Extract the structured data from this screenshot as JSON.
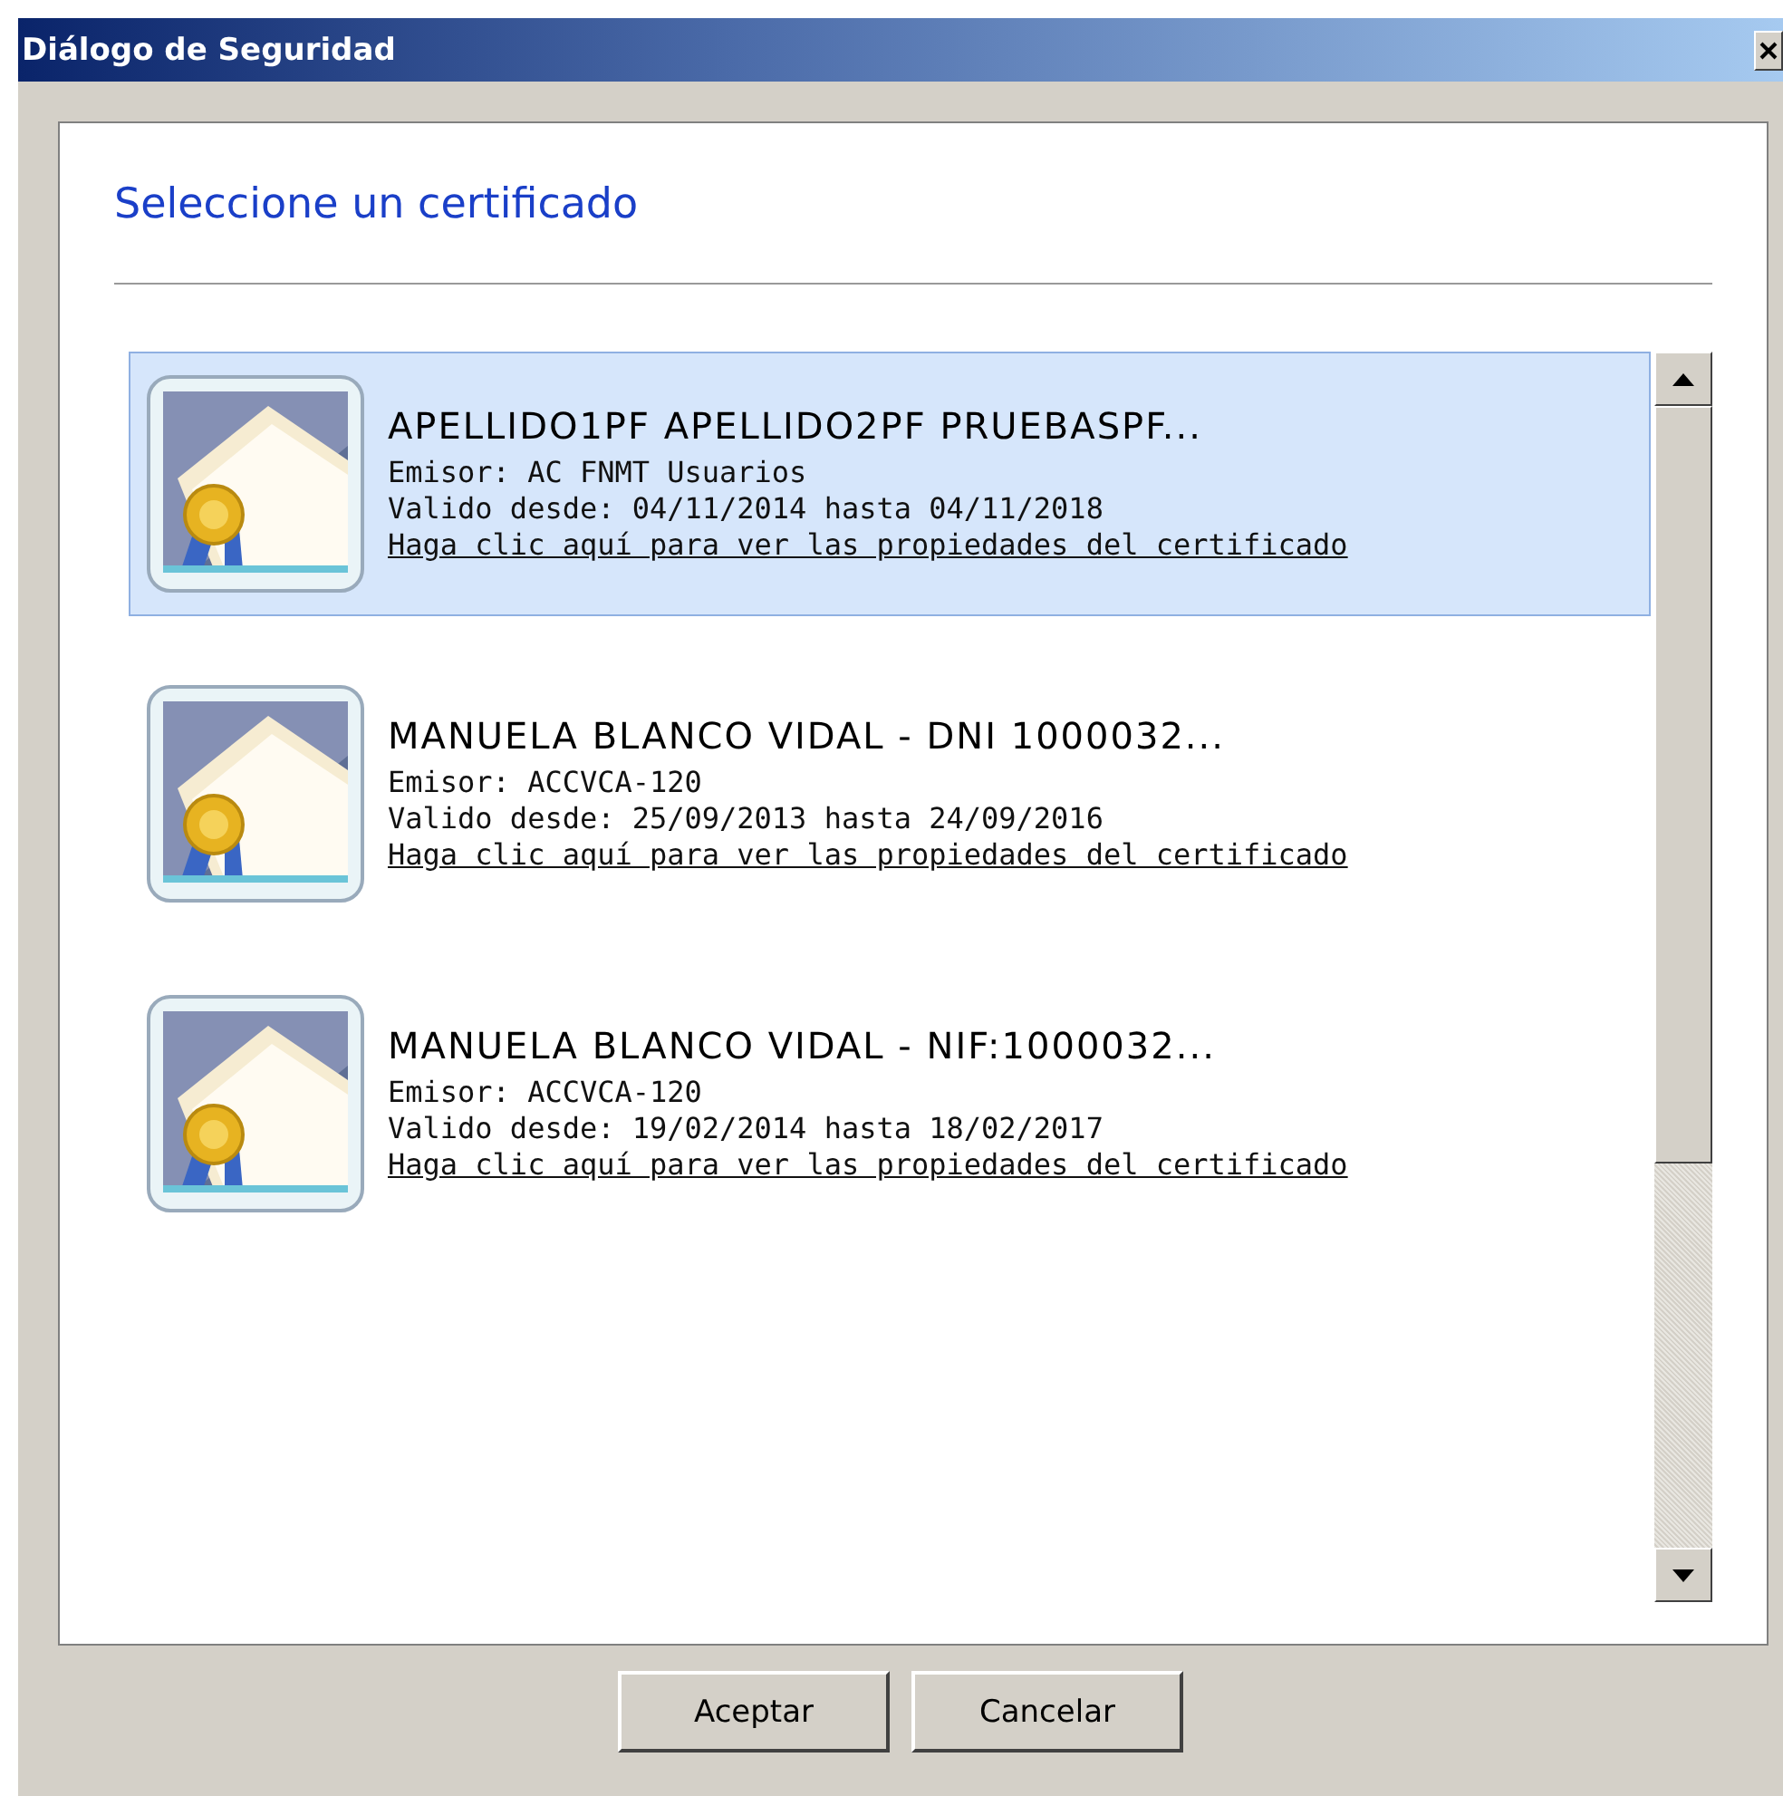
{
  "window": {
    "title": "Diálogo de Seguridad"
  },
  "heading": "Seleccione un certificado",
  "certificates": [
    {
      "name": "APELLIDO1PF APELLIDO2PF PRUEBASPF...",
      "issuer": "Emisor: AC FNMT Usuarios",
      "validity": "Valido desde: 04/11/2014 hasta 04/11/2018",
      "link": "Haga clic aquí para ver las propiedades del certificado",
      "selected": true
    },
    {
      "name": "MANUELA BLANCO VIDAL - DNI 1000032...",
      "issuer": "Emisor: ACCVCA-120",
      "validity": "Valido desde: 25/09/2013 hasta 24/09/2016",
      "link": "Haga clic aquí para ver las propiedades del certificado",
      "selected": false
    },
    {
      "name": "MANUELA BLANCO VIDAL - NIF:1000032...",
      "issuer": "Emisor: ACCVCA-120",
      "validity": "Valido desde: 19/02/2014 hasta 18/02/2017",
      "link": "Haga clic aquí para ver las propiedades del certificado",
      "selected": false
    }
  ],
  "buttons": [
    "Aceptar",
    "Cancelar"
  ]
}
